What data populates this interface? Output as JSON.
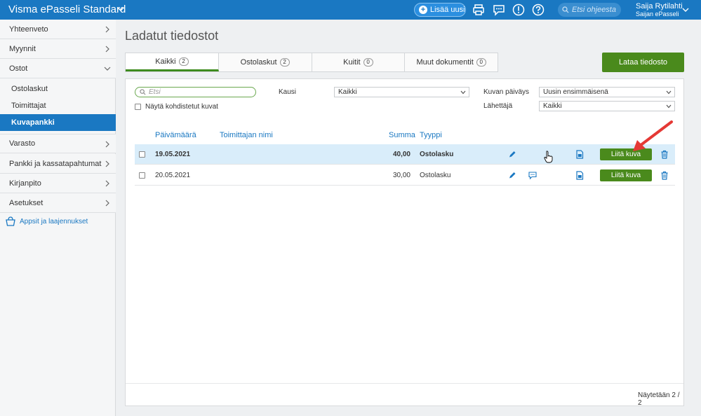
{
  "topbar": {
    "app_title": "Visma ePasseli Standard",
    "add_button": "Lisää uusi",
    "search_placeholder": "Etsi ohjeesta",
    "user_name": "Saija Rytilahti",
    "user_company": "Saijan ePasseli",
    "icons": [
      "print-icon",
      "chat-icon",
      "alert-icon",
      "help-icon"
    ]
  },
  "sidebar": {
    "items": [
      {
        "label": "Yhteenveto"
      },
      {
        "label": "Myynnit"
      },
      {
        "label": "Ostot",
        "expanded": true
      },
      {
        "label": "Varasto"
      },
      {
        "label": "Pankki ja kassatapahtumat"
      },
      {
        "label": "Kirjanpito"
      },
      {
        "label": "Asetukset"
      }
    ],
    "sub_items": [
      {
        "label": "Ostolaskut"
      },
      {
        "label": "Toimittajat"
      },
      {
        "label": "Kuvapankki",
        "active": true
      }
    ],
    "apps_link": "Appsit ja laajennukset"
  },
  "main": {
    "title": "Ladatut tiedostot",
    "tabs": [
      {
        "label": "Kaikki",
        "count": "2",
        "active": true
      },
      {
        "label": "Ostolaskut",
        "count": "2"
      },
      {
        "label": "Kuitit",
        "count": "0"
      },
      {
        "label": "Muut dokumentit",
        "count": "0"
      }
    ],
    "upload_button": "Lataa tiedosto",
    "filters": {
      "search_placeholder": "Etsi",
      "show_matched_label": "Näytä kohdistetut kuvat",
      "period_label": "Kausi",
      "period_value": "Kaikki",
      "image_date_label": "Kuvan päiväys",
      "image_date_value": "Uusin ensimmäisenä",
      "sender_label": "Lähettäjä",
      "sender_value": "Kaikki"
    },
    "table": {
      "headers": {
        "date": "Päivämäärä",
        "supplier": "Toimittajan nimi",
        "amount": "Summa",
        "type": "Tyyppi"
      },
      "rows": [
        {
          "date": "19.05.2021",
          "supplier": "",
          "amount": "40,00",
          "type": "Ostolasku",
          "highlighted": true,
          "has_comment": false,
          "attach_label": "Liitä kuva"
        },
        {
          "date": "20.05.2021",
          "supplier": "",
          "amount": "30,00",
          "type": "Ostolasku",
          "highlighted": false,
          "has_comment": true,
          "attach_label": "Liitä kuva"
        }
      ]
    },
    "showing_text": "Näytetään 2 / 2"
  },
  "colors": {
    "topbar": "#1a78c2",
    "accent_green": "#4a8a1c",
    "row_highlight": "#d9edfa",
    "annotation_arrow": "#e53935"
  }
}
